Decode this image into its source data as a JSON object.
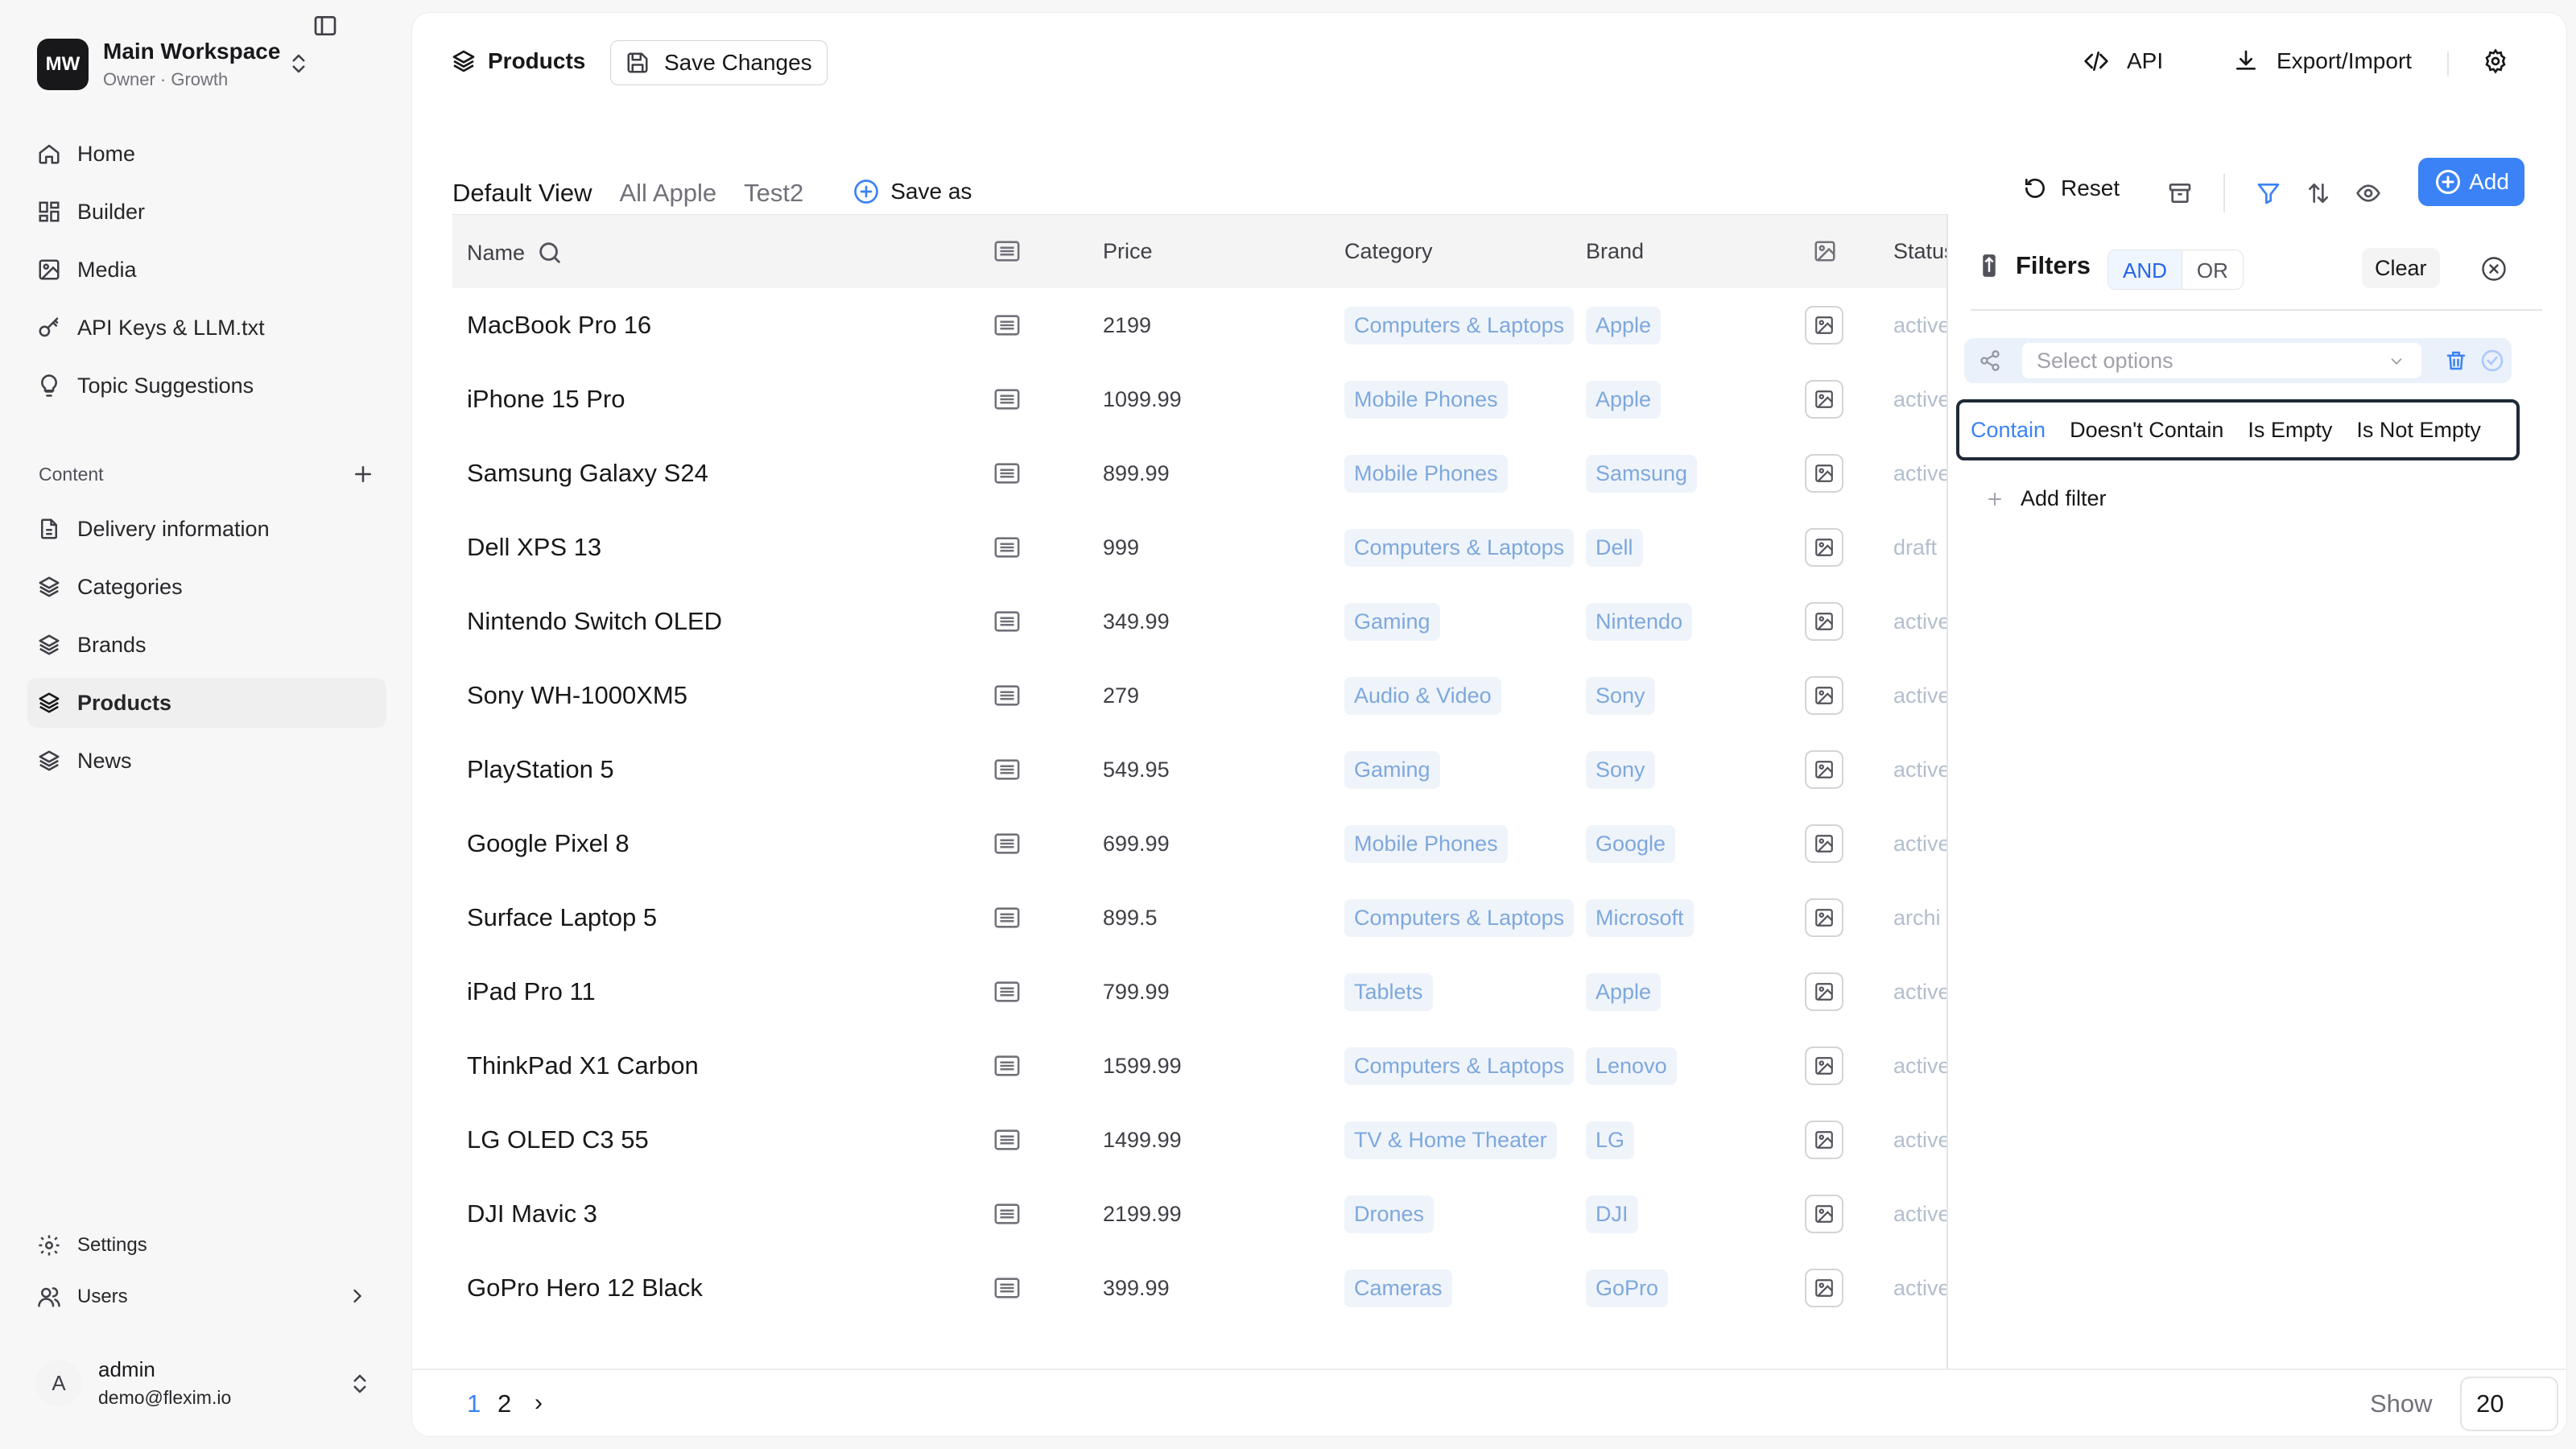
{
  "workspace": {
    "initials": "MW",
    "name": "Main Workspace",
    "role": "Owner · Growth"
  },
  "sidebar": {
    "nav": [
      {
        "label": "Home",
        "icon": "home-icon"
      },
      {
        "label": "Builder",
        "icon": "grid-icon"
      },
      {
        "label": "Media",
        "icon": "image-icon"
      },
      {
        "label": "API Keys & LLM.txt",
        "icon": "key-icon"
      },
      {
        "label": "Topic Suggestions",
        "icon": "lightbulb-icon"
      }
    ],
    "content_label": "Content",
    "content": [
      {
        "label": "Delivery information",
        "icon": "document-icon"
      },
      {
        "label": "Categories",
        "icon": "layers-icon"
      },
      {
        "label": "Brands",
        "icon": "layers-icon"
      },
      {
        "label": "Products",
        "icon": "layers-icon",
        "active": true
      },
      {
        "label": "News",
        "icon": "layers-icon"
      }
    ],
    "settings_label": "Settings",
    "users_label": "Users"
  },
  "user": {
    "initial": "A",
    "name": "admin",
    "email": "demo@flexim.io"
  },
  "topbar": {
    "title": "Products",
    "save_label": "Save Changes",
    "api_label": "API",
    "export_label": "Export/Import"
  },
  "views": {
    "tabs": [
      "Default View",
      "All Apple",
      "Test2"
    ],
    "active": 0,
    "save_as": "Save as"
  },
  "actions": {
    "reset": "Reset",
    "add": "Add"
  },
  "table": {
    "headers": {
      "name": "Name",
      "price": "Price",
      "category": "Category",
      "brand": "Brand",
      "status": "Status"
    },
    "rows": [
      {
        "name": "MacBook Pro 16",
        "price": "2199",
        "category": "Computers & Laptops",
        "brand": "Apple",
        "status": "active"
      },
      {
        "name": "iPhone 15 Pro",
        "price": "1099.99",
        "category": "Mobile Phones",
        "brand": "Apple",
        "status": "active"
      },
      {
        "name": "Samsung Galaxy S24",
        "price": "899.99",
        "category": "Mobile Phones",
        "brand": "Samsung",
        "status": "active"
      },
      {
        "name": "Dell XPS 13",
        "price": "999",
        "category": "Computers & Laptops",
        "brand": "Dell",
        "status": "draft"
      },
      {
        "name": "Nintendo Switch OLED",
        "price": "349.99",
        "category": "Gaming",
        "brand": "Nintendo",
        "status": "active"
      },
      {
        "name": "Sony WH-1000XM5",
        "price": "279",
        "category": "Audio & Video",
        "brand": "Sony",
        "status": "active"
      },
      {
        "name": "PlayStation 5",
        "price": "549.95",
        "category": "Gaming",
        "brand": "Sony",
        "status": "active"
      },
      {
        "name": "Google Pixel 8",
        "price": "699.99",
        "category": "Mobile Phones",
        "brand": "Google",
        "status": "active"
      },
      {
        "name": "Surface Laptop 5",
        "price": "899.5",
        "category": "Computers & Laptops",
        "brand": "Microsoft",
        "status": "archi"
      },
      {
        "name": "iPad Pro 11",
        "price": "799.99",
        "category": "Tablets",
        "brand": "Apple",
        "status": "active"
      },
      {
        "name": "ThinkPad X1 Carbon",
        "price": "1599.99",
        "category": "Computers & Laptops",
        "brand": "Lenovo",
        "status": "active"
      },
      {
        "name": "LG OLED C3 55",
        "price": "1499.99",
        "category": "TV & Home Theater",
        "brand": "LG",
        "status": "active"
      },
      {
        "name": "DJI Mavic 3",
        "price": "2199.99",
        "category": "Drones",
        "brand": "DJI",
        "status": "active"
      },
      {
        "name": "GoPro Hero 12 Black",
        "price": "399.99",
        "category": "Cameras",
        "brand": "GoPro",
        "status": "active"
      }
    ]
  },
  "filters": {
    "title": "Filters",
    "and_label": "AND",
    "or_label": "OR",
    "clear_label": "Clear",
    "select_placeholder": "Select options",
    "operators": [
      "Contain",
      "Doesn't Contain",
      "Is Empty",
      "Is Not Empty"
    ],
    "selected_operator": 0,
    "add_filter_label": "Add filter"
  },
  "pagination": {
    "pages": [
      "1",
      "2"
    ],
    "current": 0,
    "next": "›",
    "show_label": "Show",
    "page_size": "20"
  },
  "colors": {
    "accent": "#3b82f6",
    "tag_bg": "#eff4fb",
    "tag_text": "#7ea8dc"
  }
}
